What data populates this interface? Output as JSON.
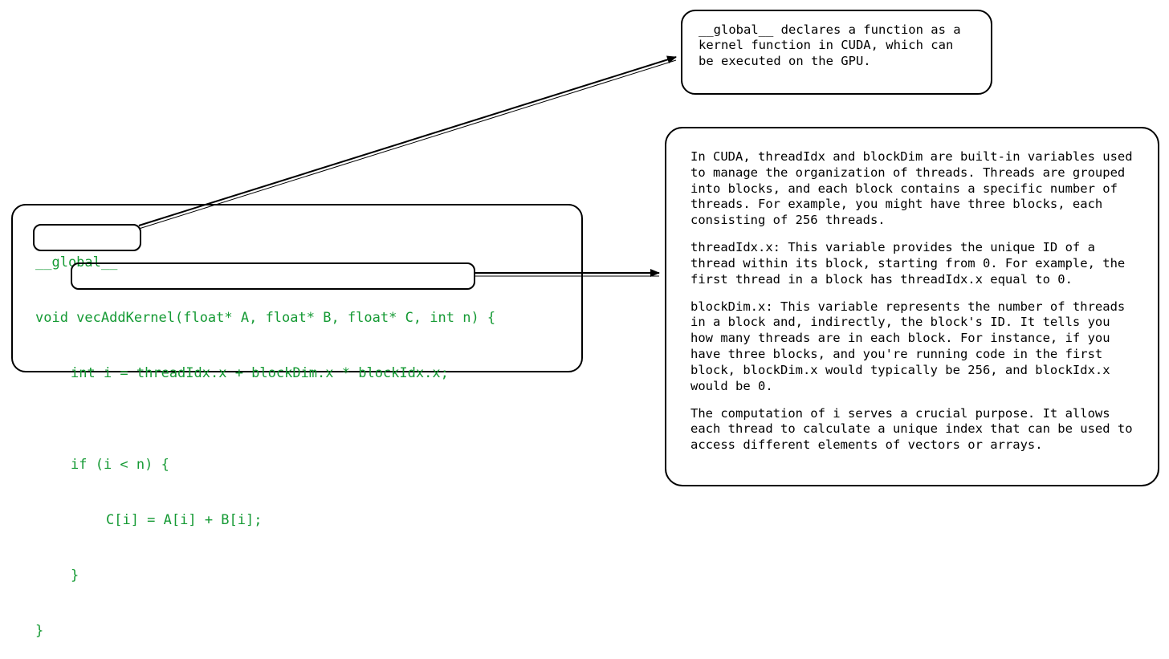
{
  "code": {
    "l1": "__global__",
    "l2": "void vecAddKernel(float* A, float* B, float* C, int n) {",
    "l3": "int i = threadIdx.x + blockDim.x * blockIdx.x;",
    "l4": "",
    "l5": "if (i < n) {",
    "l6": "C[i] = A[i] + B[i];",
    "l7": "}",
    "l8": "}"
  },
  "anno_global": {
    "p1": "__global__ declares a function as a kernel function in CUDA, which can be executed on the GPU."
  },
  "anno_thread": {
    "p1": "In CUDA, threadIdx and blockDim are built-in variables used to manage the organization of threads. Threads are grouped into blocks, and each block contains a specific number of threads. For example, you might have three blocks, each consisting of 256 threads.",
    "p2": "threadIdx.x: This variable provides the unique ID of a thread within its block, starting from 0. For example, the first thread in a block has threadIdx.x equal to 0.",
    "p3": "blockDim.x: This variable represents the number of threads in a block and, indirectly, the block's ID. It tells you how many threads are in each block. For instance, if you have three blocks, and you're running code in the first block, blockDim.x would typically be 256, and blockIdx.x would be 0.",
    "p4": "The computation of i serves a crucial purpose. It allows each thread to calculate a unique index that can be used to access different elements of vectors or arrays."
  },
  "highlights": {
    "global_label": "global-keyword-highlight",
    "idx_label": "thread-index-line-highlight"
  }
}
